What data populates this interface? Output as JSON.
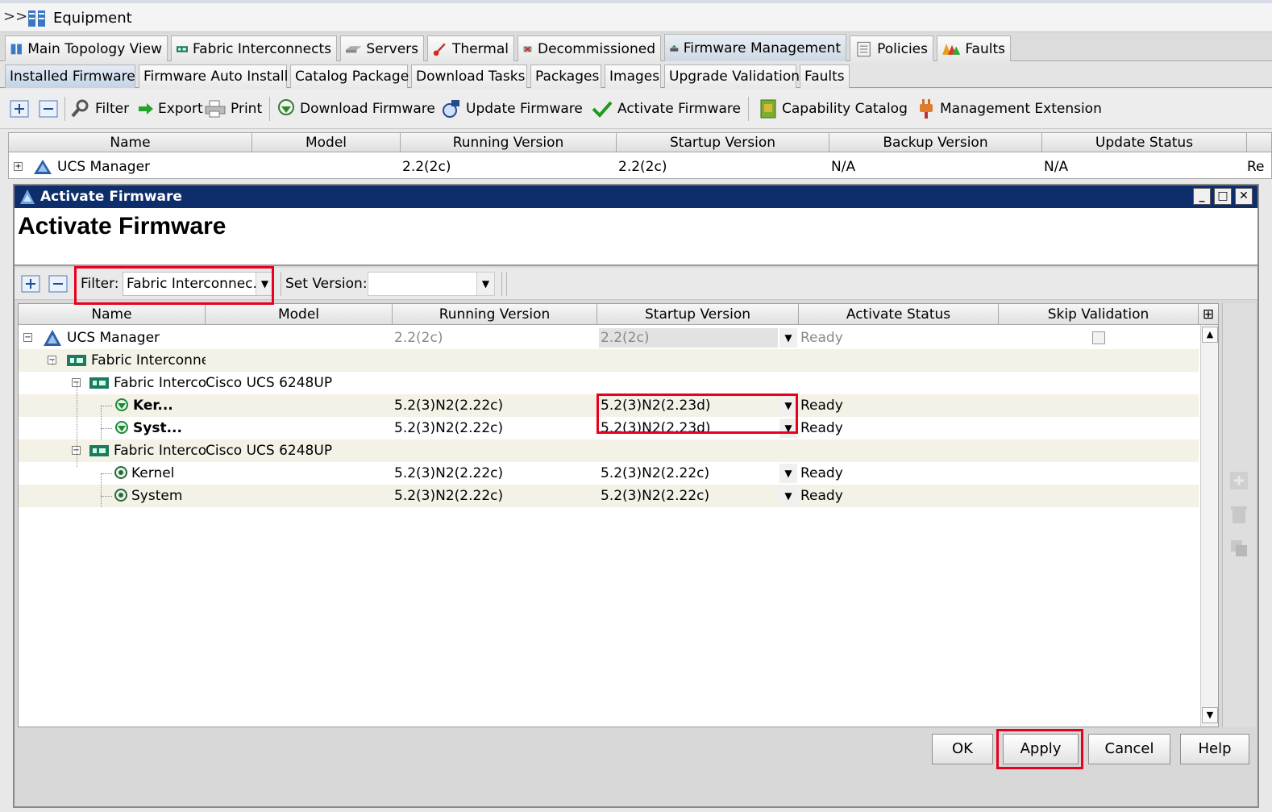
{
  "window": {
    "title": "Equipment",
    "expander": ">>"
  },
  "main_tabs": [
    {
      "label": "Main Topology View"
    },
    {
      "label": "Fabric Interconnects"
    },
    {
      "label": "Servers"
    },
    {
      "label": "Thermal"
    },
    {
      "label": "Decommissioned"
    },
    {
      "label": "Firmware Management",
      "active": true
    },
    {
      "label": "Policies"
    },
    {
      "label": "Faults"
    }
  ],
  "sub_tabs": [
    {
      "label": "Installed Firmware",
      "active": true
    },
    {
      "label": "Firmware Auto Install"
    },
    {
      "label": "Catalog Package"
    },
    {
      "label": "Download Tasks"
    },
    {
      "label": "Packages"
    },
    {
      "label": "Images"
    },
    {
      "label": "Upgrade Validation"
    },
    {
      "label": "Faults"
    }
  ],
  "toolbar": {
    "filter": "Filter",
    "export": "Export",
    "print": "Print",
    "download_firmware": "Download Firmware",
    "update_firmware": "Update Firmware",
    "activate_firmware": "Activate Firmware",
    "capability_catalog": "Capability Catalog",
    "management_extension": "Management Extension"
  },
  "installed_table": {
    "columns": [
      "Name",
      "Model",
      "Running Version",
      "Startup Version",
      "Backup Version",
      "Update Status"
    ],
    "row": {
      "name": "UCS Manager",
      "running": "2.2(2c)",
      "startup": "2.2(2c)",
      "backup": "N/A",
      "update_status": "N/A",
      "overflow": "Re"
    }
  },
  "dialog": {
    "window_title": "Activate Firmware",
    "heading": "Activate Firmware",
    "filter_label": "Filter:",
    "filter_value": "Fabric Interconnec...",
    "set_version_label": "Set Version:",
    "set_version_value": "",
    "columns": [
      "Name",
      "Model",
      "Running Version",
      "Startup Version",
      "Activate Status",
      "Skip Validation"
    ],
    "rows": [
      {
        "name": "UCS Manager",
        "model": "",
        "running": "2.2(2c)",
        "startup": "2.2(2c)",
        "status": "Ready",
        "skip": false
      },
      {
        "name": "Fabric Interconnec",
        "model": "",
        "running": "",
        "startup": "",
        "status": ""
      },
      {
        "name": "Fabric Intercor",
        "model": "Cisco UCS 6248UP",
        "running": "",
        "startup": "",
        "status": ""
      },
      {
        "name": "Ker...",
        "model": "",
        "running": "5.2(3)N2(2.22c)",
        "startup": "5.2(3)N2(2.23d)",
        "status": "Ready"
      },
      {
        "name": "Syst...",
        "model": "",
        "running": "5.2(3)N2(2.22c)",
        "startup": "5.2(3)N2(2.23d)",
        "status": "Ready"
      },
      {
        "name": "Fabric Intercor",
        "model": "Cisco UCS 6248UP",
        "running": "",
        "startup": "",
        "status": ""
      },
      {
        "name": "Kernel",
        "model": "",
        "running": "5.2(3)N2(2.22c)",
        "startup": "5.2(3)N2(2.22c)",
        "status": "Ready"
      },
      {
        "name": "System",
        "model": "",
        "running": "5.2(3)N2(2.22c)",
        "startup": "5.2(3)N2(2.22c)",
        "status": "Ready"
      }
    ],
    "buttons": {
      "ok": "OK",
      "apply": "Apply",
      "cancel": "Cancel",
      "help": "Help"
    }
  },
  "colors": {
    "title_bar": "#0d2d6b",
    "highlight": "#e8001c",
    "row_alt": "#f4f1e7"
  }
}
